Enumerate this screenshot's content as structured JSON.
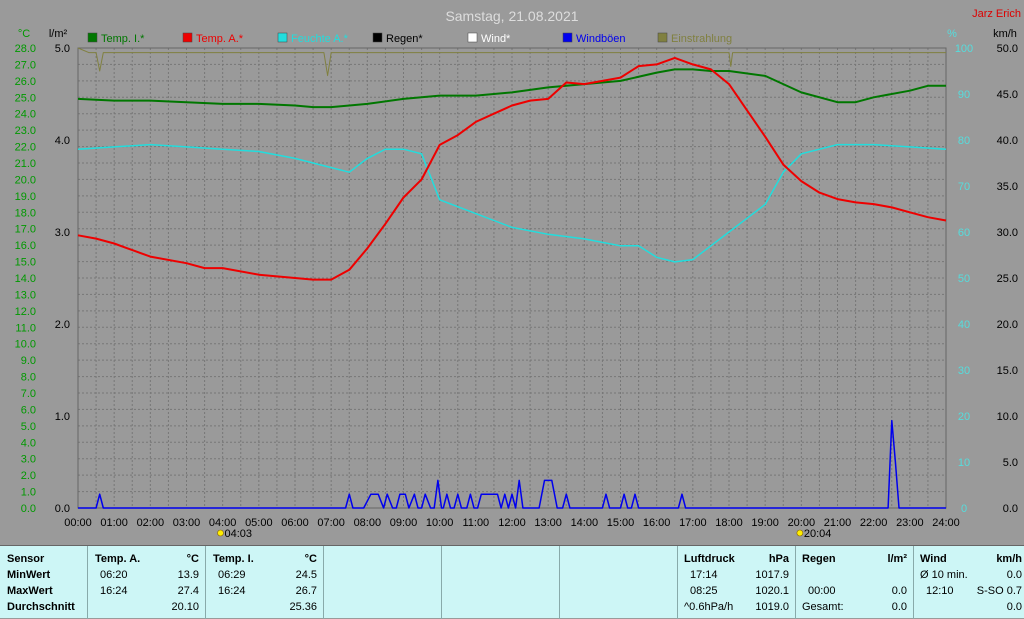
{
  "header": {
    "title": "Samstag, 21.08.2021",
    "author": "Jarz Erich"
  },
  "colors": {
    "background": "#9a9a9a",
    "grid": "#777777",
    "temp_inside": "#007700",
    "temp_outside": "#ee0000",
    "humidity": "#22dddd",
    "rain": "#000000",
    "wind": "#ffffff",
    "gusts": "#0000ee",
    "radiation": "#808040",
    "left_axis": "#009900",
    "right_axis": "#55dddd"
  },
  "chart_data": {
    "type": "line",
    "title": "Samstag, 21.08.2021",
    "axes": {
      "temp": {
        "unit": "°C",
        "range": [
          0,
          28
        ],
        "step": 1
      },
      "rain": {
        "unit": "l/m²",
        "range": [
          0,
          5
        ],
        "ticks": [
          "0.0",
          "1.0",
          "2.0",
          "3.0",
          "4.0",
          "5.0"
        ]
      },
      "humidity": {
        "unit": "%",
        "range": [
          0,
          100
        ],
        "ticks": [
          "0",
          "10",
          "20",
          "30",
          "40",
          "50",
          "60",
          "70",
          "80",
          "90",
          "100"
        ]
      },
      "wind": {
        "unit": "km/h",
        "range": [
          0,
          50
        ],
        "ticks": [
          "0.0",
          "5.0",
          "10.0",
          "15.0",
          "20.0",
          "25.0",
          "30.0",
          "35.0",
          "40.0",
          "45.0",
          "50.0"
        ]
      },
      "time": {
        "ticks": [
          "00:00",
          "01:00",
          "02:00",
          "03:00",
          "04:00",
          "05:00",
          "06:00",
          "07:00",
          "08:00",
          "09:00",
          "10:00",
          "11:00",
          "12:00",
          "13:00",
          "14:00",
          "15:00",
          "16:00",
          "17:00",
          "18:00",
          "19:00",
          "20:00",
          "21:00",
          "22:00",
          "23:00",
          "24:00"
        ]
      }
    },
    "sun": {
      "sunrise": "04:03",
      "sunset": "20:04",
      "sunrise_hour": 4.05,
      "sunset_hour": 20.07
    },
    "legend": [
      {
        "name": "Temp. I.*",
        "color": "#007700"
      },
      {
        "name": "Temp. A.*",
        "color": "#ee0000"
      },
      {
        "name": "Feuchte A.*",
        "color": "#22dddd"
      },
      {
        "name": "Regen*",
        "color": "#000000"
      },
      {
        "name": "Wind*",
        "color": "#ffffff"
      },
      {
        "name": "Windböen",
        "color": "#0000ee"
      },
      {
        "name": "Einstrahlung",
        "color": "#808040"
      }
    ],
    "series": [
      {
        "name": "Temp. I.*",
        "axis": "temp",
        "color": "#007700",
        "x": [
          0,
          1,
          2,
          3,
          4,
          5,
          6,
          6.5,
          7,
          7.5,
          8,
          9,
          10,
          11,
          12,
          13,
          14,
          15,
          16,
          16.5,
          17,
          17.5,
          18,
          19,
          20,
          21,
          21.5,
          22,
          23,
          23.5,
          24
        ],
        "y": [
          24.9,
          24.8,
          24.8,
          24.7,
          24.6,
          24.6,
          24.5,
          24.4,
          24.4,
          24.5,
          24.6,
          24.9,
          25.1,
          25.1,
          25.3,
          25.6,
          25.8,
          26.0,
          26.5,
          26.7,
          26.7,
          26.6,
          26.6,
          26.3,
          25.3,
          24.7,
          24.7,
          25.0,
          25.4,
          25.7,
          25.7
        ]
      },
      {
        "name": "Temp. A.*",
        "axis": "temp",
        "color": "#ee0000",
        "x": [
          0,
          0.5,
          1,
          1.5,
          2,
          3,
          3.5,
          4,
          5,
          6,
          6.5,
          7,
          7.5,
          8,
          8.5,
          9,
          9.5,
          10,
          10.5,
          11,
          11.5,
          12,
          12.5,
          13,
          13.5,
          14,
          14.5,
          15,
          15.5,
          16,
          16.5,
          17,
          17.5,
          18,
          18.5,
          19,
          19.5,
          20,
          20.5,
          21,
          21.5,
          22,
          22.5,
          23,
          23.5,
          24
        ],
        "y": [
          16.6,
          16.4,
          16.1,
          15.7,
          15.3,
          14.9,
          14.6,
          14.6,
          14.2,
          14.0,
          13.9,
          13.9,
          14.5,
          15.8,
          17.3,
          18.9,
          20.0,
          22.1,
          22.7,
          23.5,
          24.0,
          24.5,
          24.8,
          24.9,
          25.9,
          25.8,
          26.0,
          26.2,
          26.9,
          27.0,
          27.4,
          27.0,
          26.7,
          25.8,
          24.2,
          22.6,
          20.9,
          19.9,
          19.2,
          18.8,
          18.6,
          18.5,
          18.3,
          18.0,
          17.7,
          17.5
        ]
      },
      {
        "name": "Feuchte A.*",
        "axis": "humidity",
        "color": "#22dddd",
        "x": [
          0,
          1,
          2,
          3,
          4,
          5,
          6,
          7,
          7.5,
          8,
          8.5,
          9,
          9.5,
          10,
          11,
          12,
          13,
          14,
          15,
          15.5,
          16,
          16.5,
          17,
          17.5,
          18,
          18.5,
          19,
          19.5,
          20,
          21,
          22,
          23,
          24
        ],
        "y": [
          78,
          78.5,
          79,
          78.5,
          78,
          77.5,
          76,
          74,
          73,
          76,
          78,
          78,
          77,
          67,
          64,
          61,
          59.5,
          58.5,
          57,
          57,
          54.5,
          53.5,
          54,
          57,
          60,
          63,
          66,
          73,
          77,
          79,
          79,
          78.5,
          78
        ]
      },
      {
        "name": "Windböen",
        "axis": "wind",
        "color": "#0000ee",
        "x": [
          0,
          0.5,
          0.6,
          0.7,
          7.4,
          7.5,
          7.6,
          7.9,
          8.1,
          8.3,
          8.45,
          8.55,
          8.7,
          8.8,
          8.9,
          9.05,
          9.15,
          9.3,
          9.4,
          9.5,
          9.6,
          9.75,
          9.85,
          9.95,
          10.05,
          10.1,
          10.2,
          10.3,
          10.4,
          10.5,
          10.6,
          10.75,
          10.85,
          10.95,
          11.05,
          11.15,
          11.3,
          11.4,
          11.5,
          11.6,
          11.7,
          11.8,
          11.9,
          12.0,
          12.1,
          12.2,
          12.3,
          12.75,
          12.9,
          13.1,
          13.25,
          13.4,
          13.5,
          13.6,
          14.5,
          14.6,
          14.7,
          15.0,
          15.1,
          15.2,
          15.3,
          15.4,
          15.5,
          15.6,
          16.6,
          16.7,
          16.8,
          22.4,
          22.5,
          22.6,
          22.7,
          24
        ],
        "y": [
          0,
          0,
          1.5,
          0,
          0,
          1.5,
          0,
          0,
          1.5,
          1.5,
          0,
          1.5,
          0,
          0,
          1.5,
          1.5,
          0,
          1.5,
          0,
          0,
          1.5,
          0,
          0,
          3,
          0,
          0,
          1.5,
          0,
          0,
          1.5,
          0,
          0,
          1.5,
          0,
          0,
          1.5,
          1.5,
          1.5,
          1.5,
          1.5,
          0,
          1.5,
          0,
          1.5,
          0,
          3,
          0,
          0,
          3,
          3,
          0,
          0,
          1.5,
          0,
          0,
          1.5,
          0,
          0,
          1.5,
          0,
          0,
          1.5,
          0,
          0,
          0,
          1.5,
          0,
          0,
          9.5,
          5,
          0,
          0
        ]
      },
      {
        "name": "Einstrahlung",
        "axis": "radiation",
        "color": "#808040",
        "x": [
          0,
          0.3,
          0.5,
          0.6,
          0.7,
          1.5,
          3.0,
          4.0,
          5.0,
          6.5,
          6.8,
          6.9,
          7.0,
          8.0,
          9.0,
          10.0,
          12.0,
          14.0,
          16.0,
          17.5,
          18.0,
          18.05,
          18.1,
          19.0,
          20.0,
          20.5,
          24
        ],
        "y": [
          100,
          99,
          99,
          95,
          99,
          99,
          99,
          99,
          99,
          99,
          99,
          94,
          99,
          99,
          99,
          99,
          99,
          99,
          99,
          99,
          99,
          96,
          99,
          99,
          99,
          99,
          99
        ]
      }
    ]
  },
  "summary": {
    "labels": {
      "sensor": "Sensor",
      "min": "MinWert",
      "max": "MaxWert",
      "avg": "Durchschnitt"
    },
    "temp_a": {
      "title": "Temp. A.",
      "unit": "°C",
      "min_time": "06:20",
      "min_value": "13.9",
      "max_time": "16:24",
      "max_value": "27.4",
      "avg": "20.10"
    },
    "temp_i": {
      "title": "Temp. I.",
      "unit": "°C",
      "min_time": "06:29",
      "min_value": "24.5",
      "max_time": "16:24",
      "max_value": "26.7",
      "avg": "25.36"
    },
    "pressure": {
      "title": "Luftdruck",
      "unit": "hPa",
      "min_time": "17:14",
      "min_value": "1017.9",
      "max_time": "08:25",
      "max_value": "1020.1",
      "trend_label": "^0.6hPa/h",
      "current": "1019.0"
    },
    "rain": {
      "title": "Regen",
      "unit": "l/m²",
      "max_time": "00:00",
      "max_value": "0.0",
      "total_label": "Gesamt:",
      "total": "0.0"
    },
    "wind": {
      "title": "Wind",
      "unit": "km/h",
      "avg_label": "Ø 10 min.",
      "avg_value": "0.0",
      "max_time": "12:10",
      "max_value": "S-SO 0.7",
      "current": "0.0"
    }
  }
}
